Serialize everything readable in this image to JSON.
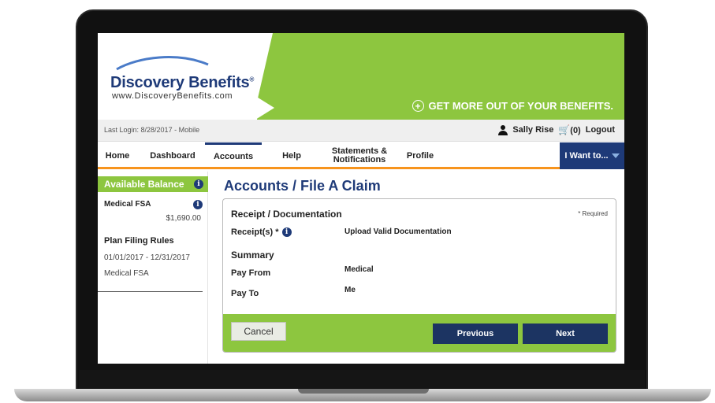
{
  "header": {
    "brand_name": "Discovery Benefits",
    "brand_mark": "®",
    "brand_url": "www.DiscoveryBenefits.com",
    "tagline_icon": "+",
    "tagline": "GET MORE OUT OF YOUR BENEFITS."
  },
  "status_bar": {
    "last_login": "Last Login: 8/28/2017 - Mobile",
    "user_name": "Sally Rise",
    "cart_icon": "🛒",
    "cart_count": "(0)",
    "logout": "Logout"
  },
  "nav": {
    "items": [
      {
        "label": "Home"
      },
      {
        "label": "Dashboard"
      },
      {
        "label": "Accounts"
      },
      {
        "label": "Help"
      },
      {
        "label": "Statements & Notifications"
      },
      {
        "label": "Profile"
      }
    ],
    "active": "Accounts",
    "i_want_to": "I Want to..."
  },
  "sidebar": {
    "available_balance": "Available Balance",
    "account_name": "Medical FSA",
    "account_amount": "$1,690.00",
    "plan_filing_rules": "Plan Filing Rules",
    "plan_dates": "01/01/2017 - 12/31/2017",
    "plan_name": "Medical FSA"
  },
  "main": {
    "page_title": "Accounts / File A Claim",
    "section_heading": "Receipt / Documentation",
    "required_note": "* Required",
    "receipt_label": "Receipt(s) *",
    "upload_link": "Upload Valid Documentation",
    "summary_heading": "Summary",
    "pay_from_label": "Pay From",
    "pay_from_value": "Medical",
    "pay_to_label": "Pay To",
    "pay_to_value": "Me",
    "cancel": "Cancel",
    "previous": "Previous",
    "next": "Next"
  },
  "icons": {
    "info": "i"
  },
  "colors": {
    "brand_green": "#8dc63f",
    "brand_navy": "#1e3a78",
    "accent_orange": "#f7941d"
  }
}
